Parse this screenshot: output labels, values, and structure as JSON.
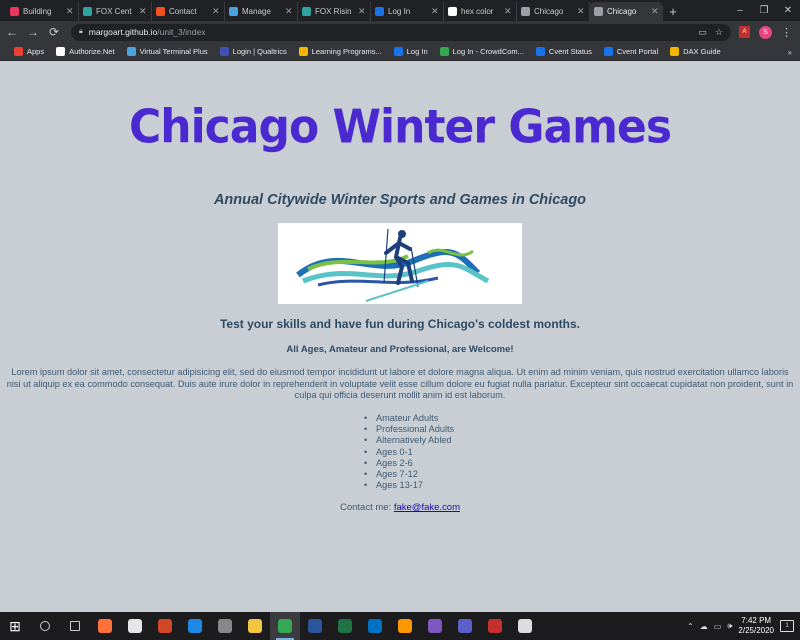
{
  "browser": {
    "tabs": [
      {
        "label": "Building",
        "color": "#e8365d"
      },
      {
        "label": "FOX Cent",
        "color": "#2ea3a0"
      },
      {
        "label": "Contact",
        "color": "#f25022"
      },
      {
        "label": "Manage",
        "color": "#4aa3df"
      },
      {
        "label": "FOX Risin",
        "color": "#2ea3a0"
      },
      {
        "label": "Log In",
        "color": "#1a73e8"
      },
      {
        "label": "hex color",
        "color": "#ffffff"
      },
      {
        "label": "Chicago",
        "color": "#9aa0a6"
      },
      {
        "label": "Chicago",
        "color": "#9aa0a6"
      }
    ],
    "new_tab": "+",
    "window_controls": {
      "minimize": "–",
      "maximize": "❐",
      "close": "✕"
    },
    "url_host": "margoart.github.io",
    "url_path": "/unit_3/index",
    "profile_initial": "S",
    "bookmarks": [
      {
        "label": "Apps",
        "color": "#e94235"
      },
      {
        "label": "Authorize.Net",
        "color": "#ffffff"
      },
      {
        "label": "Virtual Terminal Plus",
        "color": "#4aa3df"
      },
      {
        "label": "Login | Qualtrics",
        "color": "#3f51b5"
      },
      {
        "label": "Learning Programs...",
        "color": "#f4b400"
      },
      {
        "label": "Log In",
        "color": "#1a73e8"
      },
      {
        "label": "Log In - CrowdCom...",
        "color": "#34a853"
      },
      {
        "label": "Cvent Status",
        "color": "#1a73e8"
      },
      {
        "label": "Cvent Portal",
        "color": "#1a73e8"
      },
      {
        "label": "DAX Guide",
        "color": "#f4b400"
      }
    ],
    "bookmarks_more": "»"
  },
  "page": {
    "title": "Chicago Winter Games",
    "subtitle": "Annual Citywide Winter Sports and Games in Chicago",
    "tagline": "Test your skills and have fun during Chicago's coldest months.",
    "welcome": "All Ages, Amateur and Professional, are Welcome!",
    "lorem": "Lorem ipsum dolor sit amet, consectetur adipisicing elit, sed do eiusmod tempor incididunt ut labore et dolore magna aliqua. Ut enim ad minim veniam, quis nostrud exercitation ullamco laboris nisi ut aliquip ex ea commodo consequat. Duis aute irure dolor in reprehenderit in voluptate velit esse cillum dolore eu fugiat nulla pariatur. Excepteur sint occaecat cupidatat non proident, sunt in culpa qui officia deserunt mollit anim id est laborum.",
    "groups": [
      "Amateur Adults",
      "Professional Adults",
      "Alternatively Abled",
      "Ages 0-1",
      "Ages 2-6",
      "Ages 7-12",
      "Ages 13-17"
    ],
    "contact_label": "Contact me:",
    "contact_email": "fake@fake.com",
    "colors": {
      "title": "#4a2ad0",
      "text": "#2e4a63",
      "background": "#c9ced4"
    }
  },
  "taskbar": {
    "apps": [
      {
        "name": "search-icon",
        "color": "#cccccc"
      },
      {
        "name": "task-view-icon",
        "color": "#cccccc"
      },
      {
        "name": "firefox-icon",
        "color": "#ff7139"
      },
      {
        "name": "snip-icon",
        "color": "#e6e6e6"
      },
      {
        "name": "powerpoint-icon",
        "color": "#d24726"
      },
      {
        "name": "edge-icon",
        "color": "#1e88e5"
      },
      {
        "name": "calculator-icon",
        "color": "#888888"
      },
      {
        "name": "file-explorer-icon",
        "color": "#f4c542"
      },
      {
        "name": "chrome-icon",
        "color": "#34a853"
      },
      {
        "name": "word-icon",
        "color": "#2b579a"
      },
      {
        "name": "excel-icon",
        "color": "#217346"
      },
      {
        "name": "outlook-icon",
        "color": "#0072c6"
      },
      {
        "name": "sublime-icon",
        "color": "#ff9800"
      },
      {
        "name": "app-icon",
        "color": "#7e57c2"
      },
      {
        "name": "teams-icon",
        "color": "#5b5fc7"
      },
      {
        "name": "acrobat-icon",
        "color": "#c4302b"
      },
      {
        "name": "settings-icon",
        "color": "#dddddd"
      }
    ],
    "active_app": "chrome-icon",
    "time": "7:42 PM",
    "date": "2/25/2020"
  }
}
